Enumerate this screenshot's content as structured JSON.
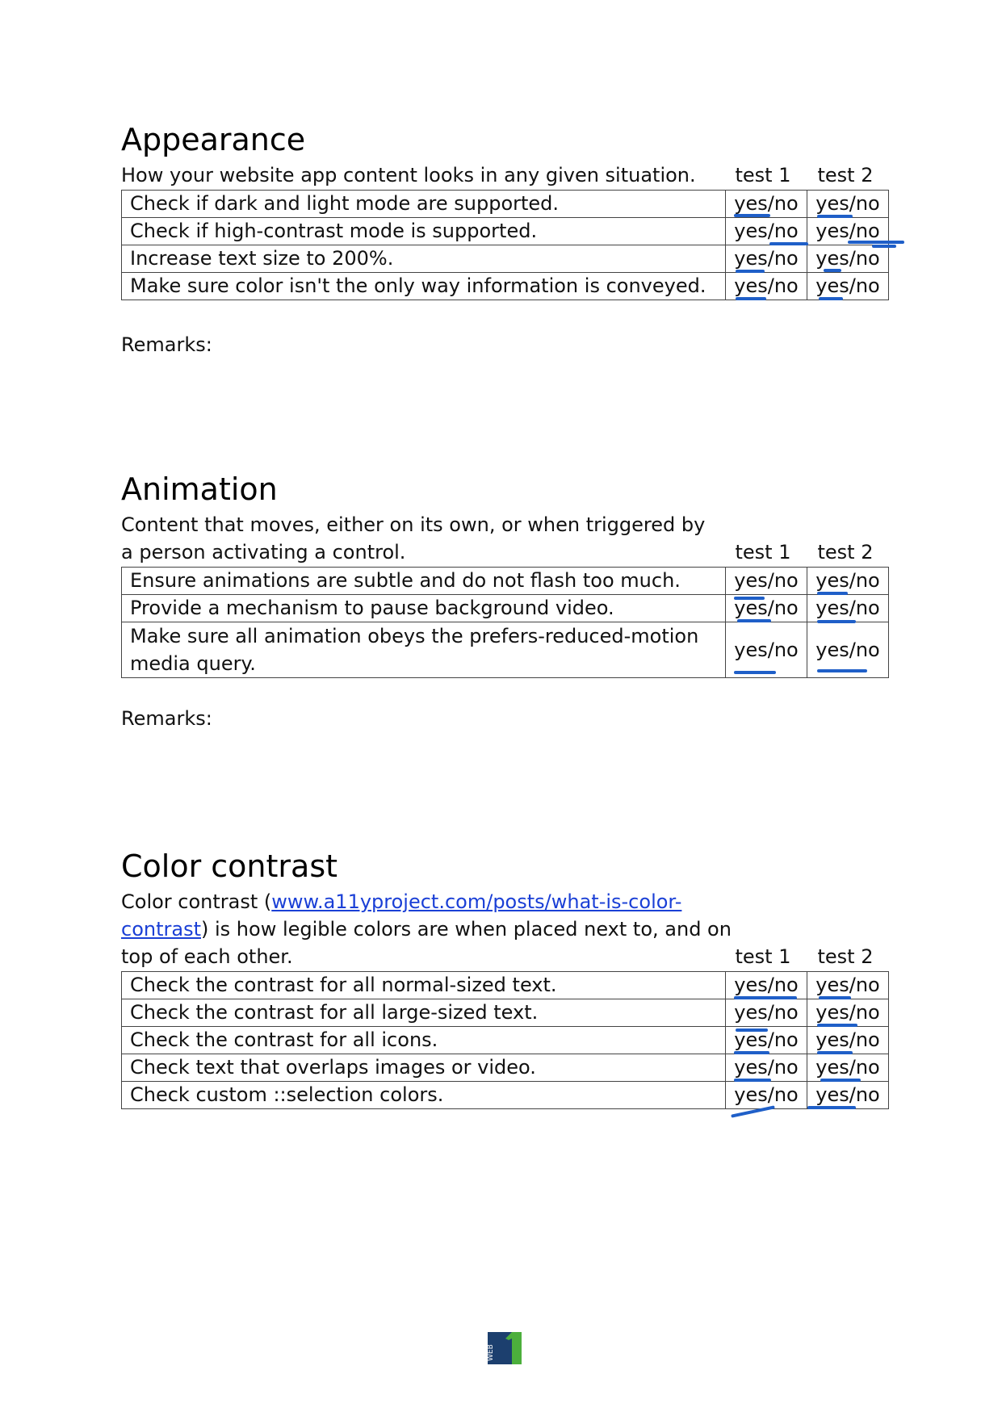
{
  "col_headers": {
    "test1": "test 1",
    "test2": "test 2"
  },
  "answer_label": "yes/no",
  "remarks_label": "Remarks:",
  "appearance": {
    "title": "Appearance",
    "description": "How your website app content looks in any given situation.",
    "rows": [
      "Check if dark and light mode are supported.",
      "Check if high-contrast mode is supported.",
      "Increase text size to 200%.",
      "Make sure color isn't the only way information is conveyed."
    ]
  },
  "animation": {
    "title": "Animation",
    "description": "Content that moves, either on its own, or when triggered by a person activating a control.",
    "rows": [
      "Ensure animations are subtle and do not flash too much.",
      "Provide a mechanism to pause background video.",
      "Make sure all animation obeys the prefers-reduced-motion media query."
    ]
  },
  "color_contrast": {
    "title": "Color contrast",
    "description_prefix": "Color contrast (",
    "link": "www.a11yproject.com/posts/what-is-color-contrast",
    "description_suffix": ") is how legible colors are when placed next to, and on top of each other.",
    "rows": [
      "Check the contrast for all normal-sized text.",
      "Check the contrast for all large-sized text.",
      "Check the contrast for all icons.",
      "Check text that overlaps images or video.",
      "Check custom ::selection colors."
    ]
  },
  "logo": {
    "text": "WEB",
    "number": "1",
    "color_dark": "#1c3f6e",
    "color_green": "#4caf3c"
  },
  "ink_color": "#1f5fc8"
}
